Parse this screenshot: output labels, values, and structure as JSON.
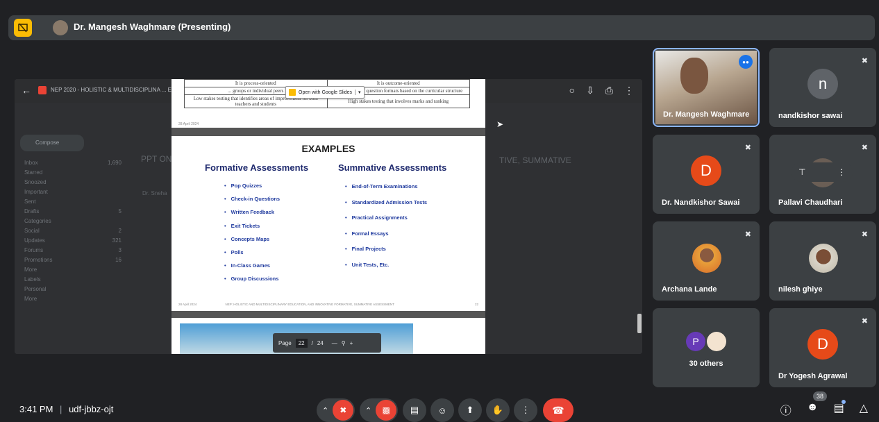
{
  "presenter_bar": {
    "title": "Dr. Mangesh Waghmare (Presenting)"
  },
  "shared_screen": {
    "doc_title": "NEP 2020 - HOLISTIC & MULTIDISCIPLINA ... E FORMATIVE SUMMATIVE.pdf",
    "open_with_label": "Open with Google Slides",
    "gmail": {
      "compose": "Compose",
      "sidebar": [
        {
          "label": "Inbox",
          "count": "1,690"
        },
        {
          "label": "Starred",
          "count": ""
        },
        {
          "label": "Snoozed",
          "count": ""
        },
        {
          "label": "Important",
          "count": ""
        },
        {
          "label": "Sent",
          "count": ""
        },
        {
          "label": "Drafts",
          "count": "5"
        },
        {
          "label": "Categories",
          "count": ""
        },
        {
          "label": "Social",
          "count": "2"
        },
        {
          "label": "Updates",
          "count": "321"
        },
        {
          "label": "Forums",
          "count": "3"
        },
        {
          "label": "Promotions",
          "count": "16"
        },
        {
          "label": "More",
          "count": ""
        },
        {
          "label": "Labels",
          "count": ""
        },
        {
          "label": "Personal",
          "count": ""
        },
        {
          "label": "More",
          "count": ""
        }
      ],
      "heading": "PPT ON",
      "heading_right": "TIVE, SUMMATIVE",
      "sender": "Dr. Sneha"
    }
  },
  "slide_top": {
    "rows": [
      [
        "It is process-oriented",
        "It is outcome-oriented"
      ],
      [
        "... groups or individual peers",
        "... ed number of question formats based on the curricular structure"
      ],
      [
        "Low stakes testing that identifies areas of improvement for both teachers and students",
        "High stakes testing that involves marks and ranking"
      ]
    ],
    "date": "28 April 2024",
    "page": "21"
  },
  "slide_main": {
    "title": "EXAMPLES",
    "formative_heading": "Formative Assessments",
    "summative_heading": "Summative Assessments",
    "formative_items": [
      "Pop Quizzes",
      "Check-in Questions",
      "Written Feedback",
      "Exit Tickets",
      "Concepts Maps",
      "Polls",
      "In-Class Games",
      "Group Discussions"
    ],
    "summative_items": [
      "End-of-Term Examinations",
      "Standardized Admission Tests",
      "Practical Assignments",
      "Formal Essays",
      "Final Projects",
      "Unit Tests, Etc."
    ],
    "footer_date": "28 April 2024",
    "footer_text": "NEP: HOLISTIC AND MULTIDISCIPLINARY EDUCATION, AND INNOVATIVE FORMATIVE, SUMMATIVE ASSESSMENT",
    "footer_page": "22"
  },
  "page_nav": {
    "label": "Page",
    "current": "22",
    "sep": "/",
    "total": "24"
  },
  "participants": [
    {
      "name": "Dr. Mangesh Waghmare",
      "type": "video",
      "speaking": true
    },
    {
      "name": "nandkishor sawai",
      "letter": "n",
      "color": "#5f6368",
      "muted": true
    },
    {
      "name": "Dr. Nandkishor Sawai",
      "letter": "D",
      "color": "#e64a19",
      "muted": true
    },
    {
      "name": "Pallavi Chaudhari",
      "type": "pinned",
      "muted": true
    },
    {
      "name": "Archana Lande",
      "type": "photo",
      "muted": true
    },
    {
      "name": "nilesh ghiye",
      "type": "photo",
      "muted": true
    },
    {
      "name": "30 others",
      "letter": "P",
      "letter_color": "#673ab7"
    },
    {
      "name": "Dr Yogesh Agrawal",
      "letter": "D",
      "color": "#e64a19",
      "muted": true
    }
  ],
  "bottom": {
    "time": "3:41 PM",
    "separator": "|",
    "meeting_code": "udf-jbbz-ojt",
    "people_count": "38"
  }
}
